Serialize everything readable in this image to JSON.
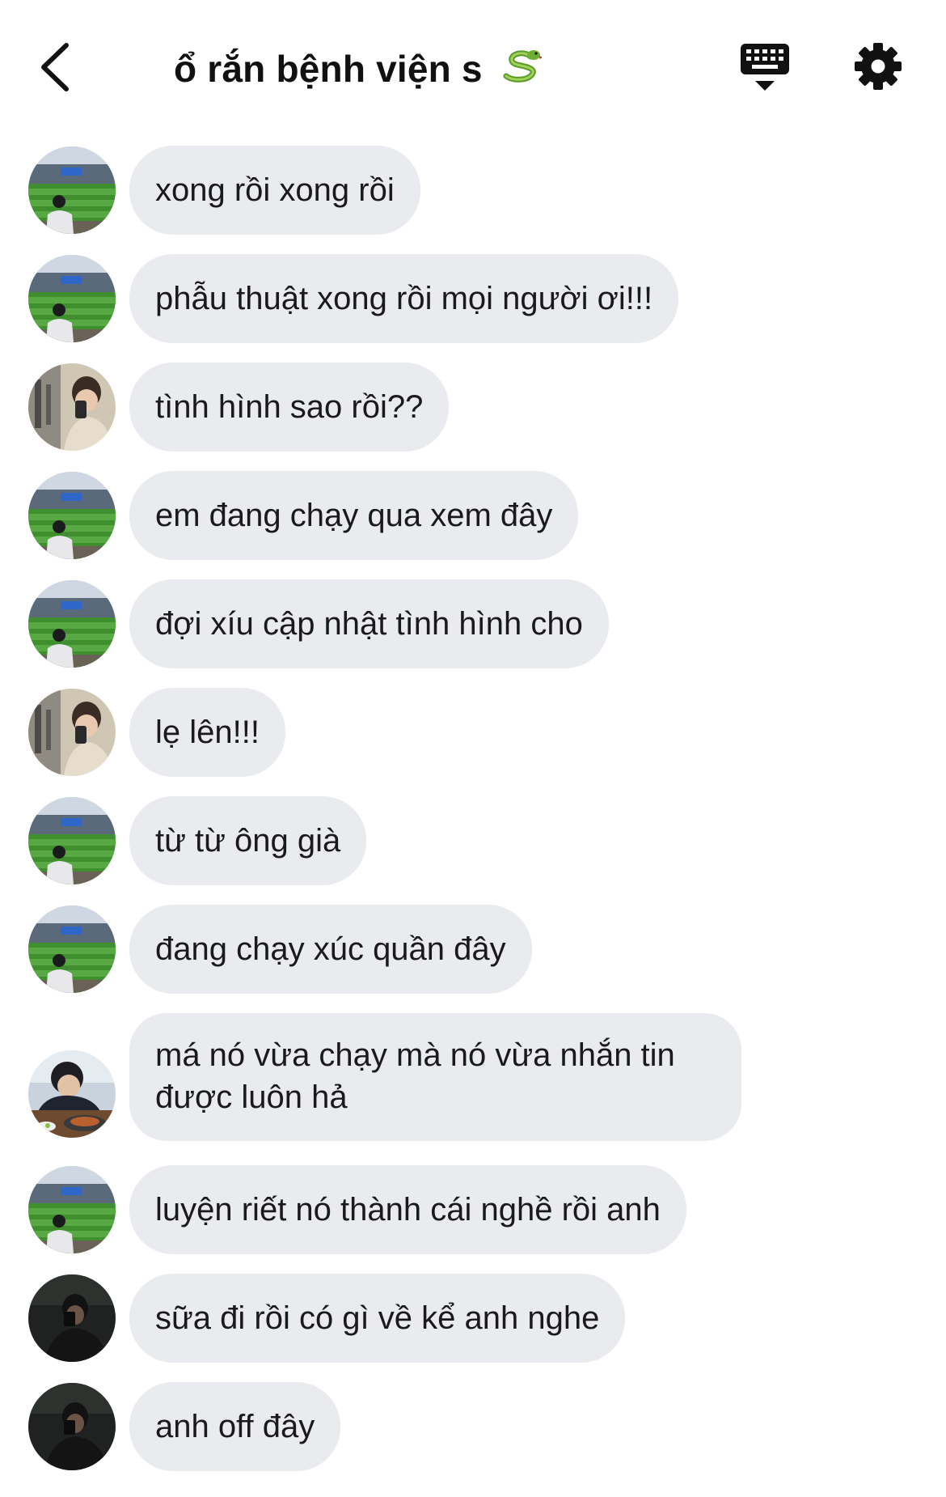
{
  "header": {
    "title": "ổ rắn bệnh viện s",
    "title_emoji": "snake",
    "back_icon": "chevron-left-icon",
    "keyboard_icon": "keyboard-icon",
    "settings_icon": "gear-icon"
  },
  "messages": [
    {
      "avatar": "stadium",
      "text": "xong rồi xong rồi"
    },
    {
      "avatar": "stadium",
      "text": "phẫu thuật xong rồi mọi người ơi!!!"
    },
    {
      "avatar": "mirror-selfie",
      "text": "tình hình sao rồi??"
    },
    {
      "avatar": "stadium",
      "text": "em đang chạy qua xem đây"
    },
    {
      "avatar": "stadium",
      "text": "đợi xíu cập nhật tình hình cho"
    },
    {
      "avatar": "mirror-selfie",
      "text": "lẹ lên!!!"
    },
    {
      "avatar": "stadium",
      "text": "từ từ ông già"
    },
    {
      "avatar": "stadium",
      "text": "đang chạy xúc quần đây"
    },
    {
      "avatar": "bbq-dinner",
      "text": "má nó vừa chạy mà nó vừa nhắn tin\nđược luôn hả"
    },
    {
      "avatar": "stadium",
      "text": "luyện riết nó thành cái nghề rồi anh"
    },
    {
      "avatar": "dark-selfie",
      "text": "sữa đi rồi có gì về kể anh nghe"
    },
    {
      "avatar": "dark-selfie",
      "text": "anh off đây"
    }
  ],
  "colors": {
    "bubble": "#e9ebef",
    "text": "#1a1a1a",
    "background": "#ffffff"
  }
}
